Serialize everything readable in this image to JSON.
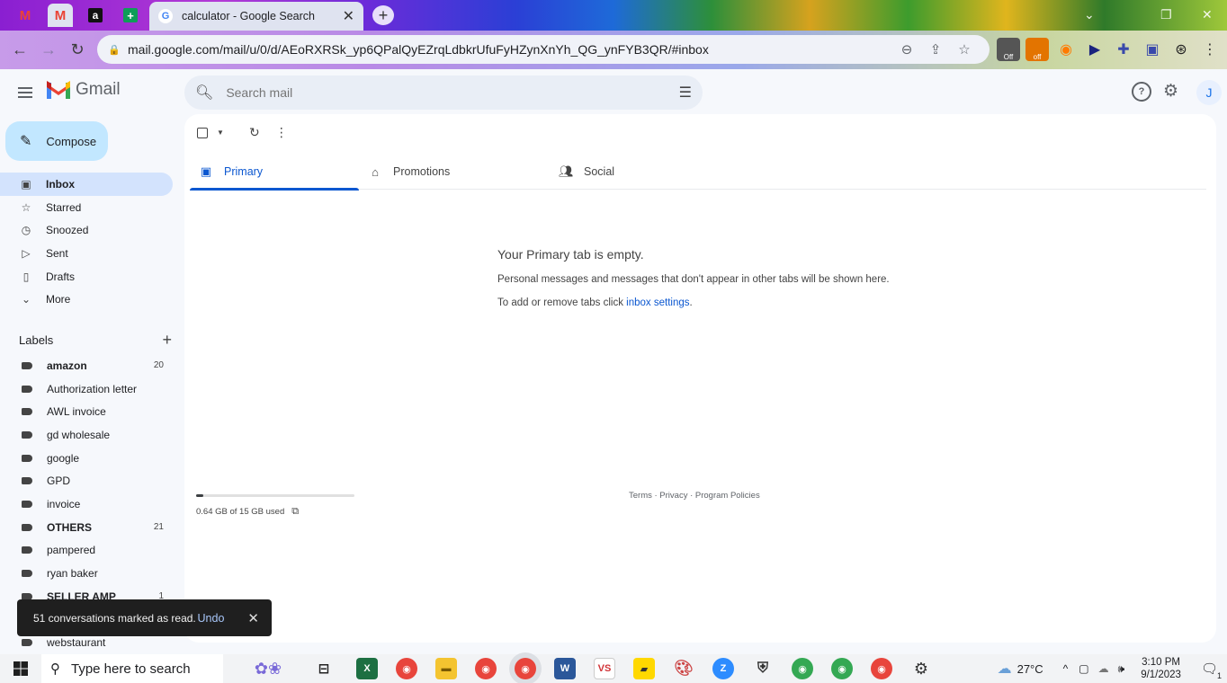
{
  "browser": {
    "active_tab_title": "calculator - Google Search",
    "url": "mail.google.com/mail/u/0/d/AEoRXRSk_yp6QPalQyEZrqLdbkrUfuFyHZynXnYh_QG_ynFYB3QR/#inbox",
    "extension_badges": [
      "Off",
      "off"
    ]
  },
  "gmail": {
    "brand": "Gmail",
    "search_placeholder": "Search mail",
    "avatar_initial": "J",
    "compose_label": "Compose",
    "nav": [
      {
        "label": "Inbox",
        "icon": "inbox-icon"
      },
      {
        "label": "Starred",
        "icon": "star-icon"
      },
      {
        "label": "Snoozed",
        "icon": "clock-icon"
      },
      {
        "label": "Sent",
        "icon": "send-icon"
      },
      {
        "label": "Drafts",
        "icon": "draft-icon"
      },
      {
        "label": "More",
        "icon": "chevron-down-icon"
      }
    ],
    "labels_heading": "Labels",
    "labels": [
      {
        "name": "amazon",
        "count": "20",
        "bold": true
      },
      {
        "name": "Authorization letter",
        "count": "",
        "bold": false
      },
      {
        "name": "AWL invoice",
        "count": "",
        "bold": false
      },
      {
        "name": "gd wholesale",
        "count": "",
        "bold": false
      },
      {
        "name": "google",
        "count": "",
        "bold": false
      },
      {
        "name": "GPD",
        "count": "",
        "bold": false
      },
      {
        "name": "invoice",
        "count": "",
        "bold": false
      },
      {
        "name": "OTHERS",
        "count": "21",
        "bold": true
      },
      {
        "name": "pampered",
        "count": "",
        "bold": false
      },
      {
        "name": "ryan baker",
        "count": "",
        "bold": false
      },
      {
        "name": "SELLER AMP",
        "count": "1",
        "bold": true
      },
      {
        "name": "",
        "count": "",
        "bold": false
      },
      {
        "name": "webstaurant",
        "count": "",
        "bold": false
      }
    ],
    "tabs": [
      {
        "label": "Primary",
        "icon": "inbox-icon"
      },
      {
        "label": "Promotions",
        "icon": "tag-icon"
      },
      {
        "label": "Social",
        "icon": "people-icon"
      }
    ],
    "empty_title": "Your Primary tab is empty.",
    "empty_desc": "Personal messages and messages that don't appear in other tabs will be shown here.",
    "empty_hint_prefix": "To add or remove tabs click ",
    "empty_hint_link": "inbox settings",
    "empty_hint_suffix": ".",
    "storage_used_text": "0.64 GB of 15 GB used",
    "storage_used_fraction": 0.043,
    "footer_links": "Terms · Privacy · Program Policies",
    "snackbar": {
      "message": "51 conversations marked as read.",
      "undo": "Undo"
    }
  },
  "taskbar": {
    "search_placeholder": "Type here to search",
    "temperature": "27°C",
    "time": "3:10 PM",
    "date": "9/1/2023",
    "notification_count": "1"
  },
  "colors": {
    "accent": "#0b57d0",
    "compose_bg": "#c2e7ff",
    "active_nav_bg": "#d3e3fd"
  }
}
